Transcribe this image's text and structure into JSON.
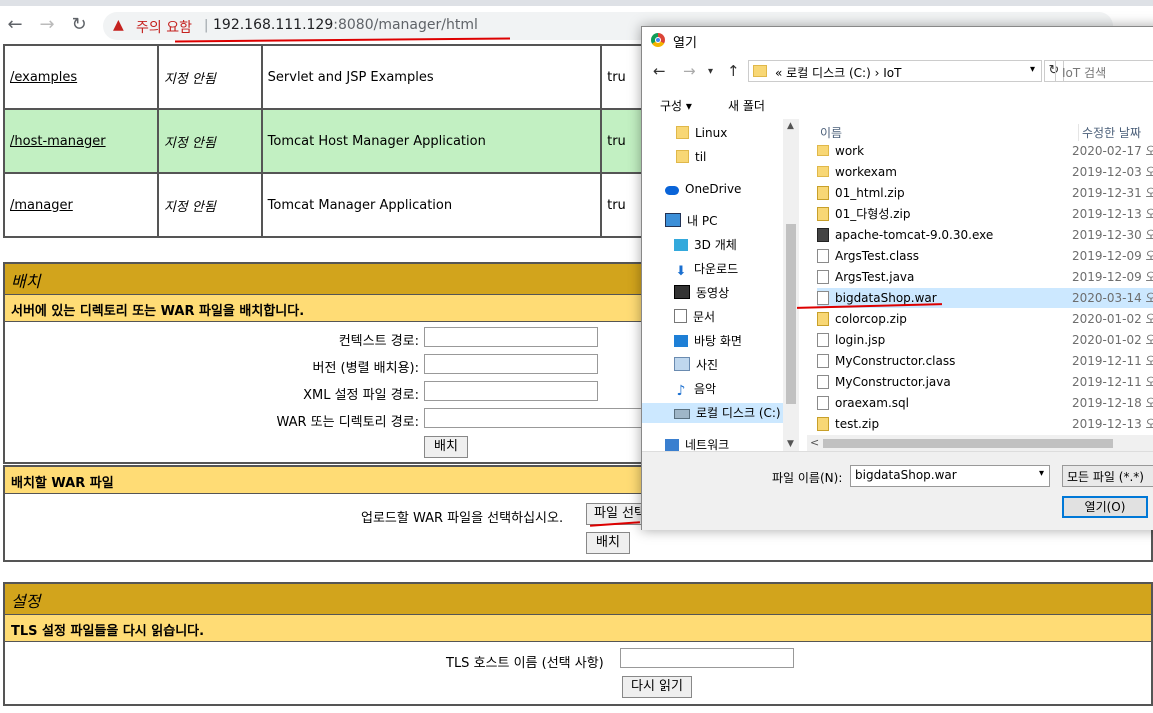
{
  "browser": {
    "back_icon": "←",
    "forward_icon": "→",
    "reload_icon": "↻",
    "security_warning": "주의 요함",
    "url_host": "192.168.111.129",
    "url_rest": ":8080/manager/html"
  },
  "apps": [
    {
      "path": "/examples",
      "version": "지정 안됨",
      "display_name": "Servlet and JSP Examples",
      "running": "tru",
      "highlight": false
    },
    {
      "path": "/host-manager",
      "version": "지정 안됨",
      "display_name": "Tomcat Host Manager Application",
      "running": "tru",
      "highlight": true
    },
    {
      "path": "/manager",
      "version": "지정 안됨",
      "display_name": "Tomcat Manager Application",
      "running": "tru",
      "highlight": false
    }
  ],
  "deploy": {
    "title": "배치",
    "subtitle": "서버에 있는 디렉토리 또는 WAR 파일을 배치합니다.",
    "context_path_label": "컨텍스트 경로:",
    "version_label": "버전 (병렬 배치용):",
    "xml_config_label": "XML 설정 파일 경로:",
    "war_dir_label": "WAR 또는 디렉토리 경로:",
    "deploy_button": "배치"
  },
  "war_upload": {
    "subtitle": "배치할 WAR 파일",
    "prompt": "업로드할 WAR 파일을 선택하십시오.",
    "choose_file_button": "파일 선택",
    "deploy_button": "배치"
  },
  "settings": {
    "title": "설정",
    "subtitle": "TLS 설정 파일들을 다시 읽습니다.",
    "tls_host_label": "TLS 호스트 이름 (선택 사항)",
    "reload_button": "다시 읽기"
  },
  "dialog": {
    "title": "열기",
    "breadcrumb": "« 로컬 디스크 (C:)  ›  IoT",
    "search_placeholder": "IoT 검색",
    "organize": "구성 ▾",
    "new_folder": "새 폴더",
    "col_name": "이름",
    "col_modified": "수정한 날짜",
    "nav_items": [
      {
        "label": "Linux",
        "icon": "folder-icon"
      },
      {
        "label": "til",
        "icon": "folder-icon"
      },
      {
        "label": "OneDrive",
        "icon": "cloud-icon"
      },
      {
        "label": "내 PC",
        "icon": "pc-icon"
      },
      {
        "label": "3D 개체",
        "icon": "cube-icon"
      },
      {
        "label": "다운로드",
        "icon": "download-icon"
      },
      {
        "label": "동영상",
        "icon": "video-icon"
      },
      {
        "label": "문서",
        "icon": "document-icon"
      },
      {
        "label": "바탕 화면",
        "icon": "desktop-icon"
      },
      {
        "label": "사진",
        "icon": "picture-icon"
      },
      {
        "label": "음악",
        "icon": "music-icon"
      },
      {
        "label": "로컬 디스크 (C:)",
        "icon": "drive-icon"
      },
      {
        "label": "네트워크",
        "icon": "network-icon"
      }
    ],
    "files": [
      {
        "name": "work",
        "date": "2020-02-17 오",
        "type": "folder"
      },
      {
        "name": "workexam",
        "date": "2019-12-03 오",
        "type": "folder"
      },
      {
        "name": "01_html.zip",
        "date": "2019-12-31 오",
        "type": "zip"
      },
      {
        "name": "01_다형성.zip",
        "date": "2019-12-13 오",
        "type": "zip"
      },
      {
        "name": "apache-tomcat-9.0.30.exe",
        "date": "2019-12-30 오",
        "type": "exe"
      },
      {
        "name": "ArgsTest.class",
        "date": "2019-12-09 오",
        "type": "doc"
      },
      {
        "name": "ArgsTest.java",
        "date": "2019-12-09 오",
        "type": "doc"
      },
      {
        "name": "bigdataShop.war",
        "date": "2020-03-14 오",
        "type": "doc",
        "selected": true
      },
      {
        "name": "colorcop.zip",
        "date": "2020-01-02 오",
        "type": "zip"
      },
      {
        "name": "login.jsp",
        "date": "2020-01-02 오",
        "type": "doc"
      },
      {
        "name": "MyConstructor.class",
        "date": "2019-12-11 오",
        "type": "doc"
      },
      {
        "name": "MyConstructor.java",
        "date": "2019-12-11 오",
        "type": "doc"
      },
      {
        "name": "oraexam.sql",
        "date": "2019-12-18 오",
        "type": "doc"
      },
      {
        "name": "test.zip",
        "date": "2019-12-13 오",
        "type": "zip"
      }
    ],
    "filename_label": "파일 이름(N):",
    "filename_value": "bigdataShop.war",
    "filetype_value": "모든 파일 (*.*)",
    "open_button": "열기(O)"
  }
}
